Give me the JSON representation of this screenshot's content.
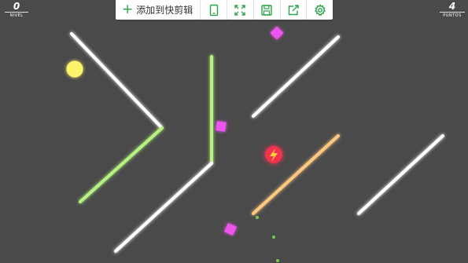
{
  "hud": {
    "level_value": "0",
    "level_label": "NIVEL",
    "points_value": "4",
    "points_label": "PUNTOS"
  },
  "toolbar": {
    "add_label": "添加到快剪辑",
    "icons": [
      "tablet-icon",
      "fullscreen-icon",
      "save-icon",
      "share-icon",
      "settings-icon"
    ],
    "accent": "#2ba34a"
  },
  "game": {
    "background": "#4a4a4a",
    "border_color": "#b8e7ff",
    "wall_colors": {
      "white": "#ffffff",
      "green": "#b5f27f",
      "orange": "#ffc880"
    },
    "gem_color": "#ee55ee",
    "ball_color": "#fff36b",
    "powerup_color": "#f2334f",
    "powerup_icon": "lightning-icon",
    "particle_color": "#6fd14a"
  }
}
